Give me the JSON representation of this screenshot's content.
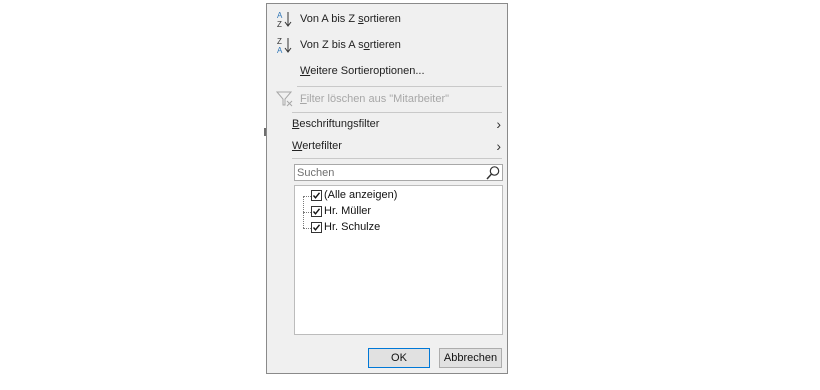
{
  "menu": {
    "sort_az": {
      "label_pre": "Von A bis Z ",
      "label_ul": "s",
      "label_post": "ortieren"
    },
    "sort_za": {
      "label_pre": "Von Z bis A s",
      "label_ul": "o",
      "label_post": "rtieren"
    },
    "more_sort": {
      "label_ul": "W",
      "label_post": "eitere Sortieroptionen..."
    },
    "clear_filter": {
      "label_ul": "F",
      "label_post": "ilter löschen aus \"Mitarbeiter\""
    },
    "label_filter": {
      "label_ul": "B",
      "label_post": "eschriftungsfilter"
    },
    "value_filter": {
      "label_ul": "W",
      "label_post": "ertefilter"
    }
  },
  "search": {
    "placeholder": "Suchen"
  },
  "list": {
    "items": [
      {
        "label": "(Alle anzeigen)",
        "checked": true
      },
      {
        "label": "Hr. Müller",
        "checked": true
      },
      {
        "label": "Hr. Schulze",
        "checked": true
      }
    ]
  },
  "buttons": {
    "ok": "OK",
    "cancel": "Abbrechen"
  },
  "colors": {
    "ok_border": "#0078d7",
    "sort_blue": "#2e75b6"
  }
}
